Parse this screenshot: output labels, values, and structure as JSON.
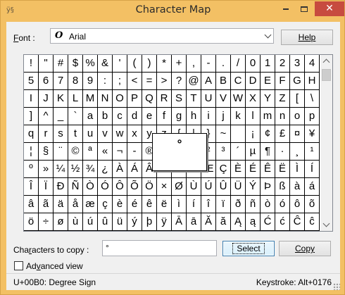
{
  "window": {
    "title": "Character Map",
    "minimize_icon": "minimize-icon",
    "maximize_icon": "maximize-icon",
    "close_glyph": "✕",
    "accent": "#f3c064",
    "close_color": "#c74b3f"
  },
  "font": {
    "label_prefix": "F",
    "label_rest": "ont :",
    "type_glyph": "O",
    "value": "Arial"
  },
  "buttons": {
    "help": "Help",
    "select": "Select",
    "copy": "Copy"
  },
  "grid": {
    "rows": [
      [
        "!",
        "\"",
        "#",
        "$",
        "%",
        "&",
        "'",
        "(",
        ")",
        "*",
        "+",
        ",",
        "-",
        ".",
        "/",
        "0",
        "1",
        "2",
        "3",
        "4"
      ],
      [
        "5",
        "6",
        "7",
        "8",
        "9",
        ":",
        ";",
        "<",
        "=",
        ">",
        "?",
        "@",
        "A",
        "B",
        "C",
        "D",
        "E",
        "F",
        "G",
        "H"
      ],
      [
        "I",
        "J",
        "K",
        "L",
        "M",
        "N",
        "O",
        "P",
        "Q",
        "R",
        "S",
        "T",
        "U",
        "V",
        "W",
        "X",
        "Y",
        "Z",
        "[",
        "\\"
      ],
      [
        "]",
        "^",
        "_",
        "`",
        "a",
        "b",
        "c",
        "d",
        "e",
        "f",
        "g",
        "h",
        "i",
        "j",
        "k",
        "l",
        "m",
        "n",
        "o",
        "p"
      ],
      [
        "q",
        "r",
        "s",
        "t",
        "u",
        "v",
        "w",
        "x",
        "y",
        "z",
        "{",
        "|",
        "}",
        "~",
        " ",
        "¡",
        "¢",
        "£",
        "¤",
        "¥"
      ],
      [
        "¦",
        "§",
        "¨",
        "©",
        "ª",
        "«",
        "¬",
        "-",
        "®",
        "¯",
        "°",
        "±",
        "²",
        "³",
        "´",
        "µ",
        "¶",
        "·",
        "¸",
        "¹"
      ],
      [
        "º",
        "»",
        "¼",
        "½",
        "¾",
        "¿",
        "À",
        "Á",
        "Â",
        "Ã",
        "Ä",
        "Å",
        "Æ",
        "Ç",
        "È",
        "É",
        "Ê",
        "Ë",
        "Ì",
        "Í"
      ],
      [
        "Î",
        "Ï",
        "Ð",
        "Ñ",
        "Ò",
        "Ó",
        "Ô",
        "Õ",
        "Ö",
        "×",
        "Ø",
        "Ù",
        "Ú",
        "Û",
        "Ü",
        "Ý",
        "Þ",
        "ß",
        "à",
        "á"
      ],
      [
        "â",
        "ã",
        "ä",
        "å",
        "æ",
        "ç",
        "è",
        "é",
        "ê",
        "ë",
        "ì",
        "í",
        "î",
        "ï",
        "ð",
        "ñ",
        "ò",
        "ó",
        "ô",
        "õ"
      ],
      [
        "ö",
        "÷",
        "ø",
        "ù",
        "ú",
        "û",
        "ü",
        "ý",
        "þ",
        "ÿ",
        "Ā",
        "ā",
        "Ă",
        "ă",
        "Ą",
        "ą",
        "Ć",
        "ć",
        "Ĉ",
        "ĉ"
      ]
    ],
    "zoom_char": "°",
    "scroll_up_icon": "scroll-up-icon",
    "scroll_down_icon": "scroll-down-icon"
  },
  "copy": {
    "label_prefix": "Cha",
    "label_u": "r",
    "label_rest": "acters to copy :",
    "value": "°"
  },
  "advanced": {
    "label_prefix": "Ad",
    "label_u": "v",
    "label_rest": "anced view",
    "checked": false
  },
  "status": {
    "left": "U+00B0: Degree Sign",
    "right": "Keystroke: Alt+0176"
  }
}
